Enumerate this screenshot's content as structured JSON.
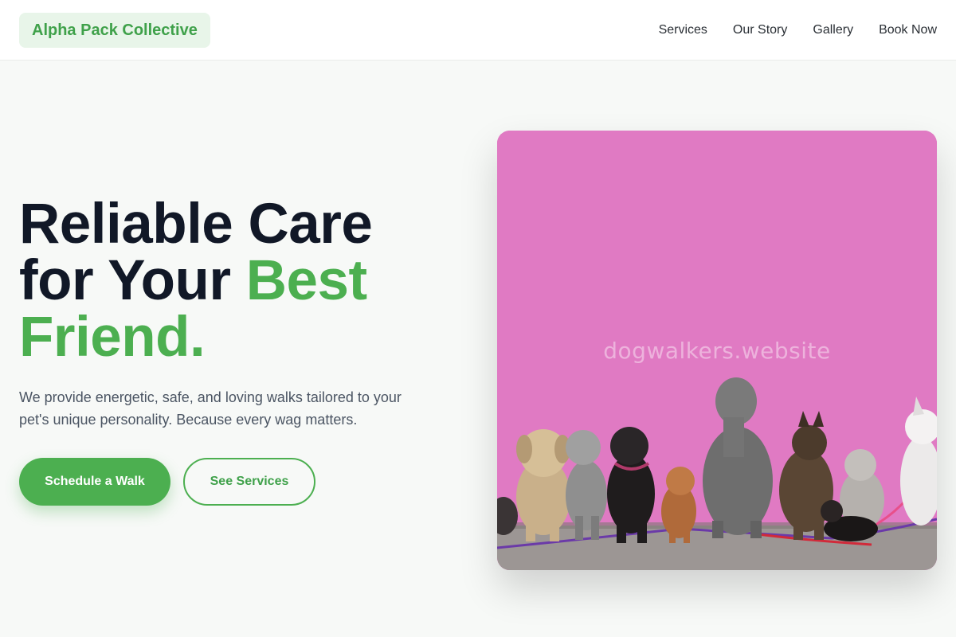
{
  "brand": {
    "name": "Alpha Pack Collective",
    "accent_color": "#4caf50"
  },
  "nav": {
    "items": [
      {
        "label": "Services"
      },
      {
        "label": "Our Story"
      },
      {
        "label": "Gallery"
      },
      {
        "label": "Book Now"
      }
    ]
  },
  "hero": {
    "headline_line1": "Reliable Care",
    "headline_line2_plain": "for Your ",
    "headline_line2_accent": "Best",
    "headline_line3_accent": "Friend.",
    "subtext": "We provide energetic, safe, and loving walks tailored to your pet's unique personality. Because every wag matters.",
    "primary_cta": "Schedule a Walk",
    "secondary_cta": "See Services"
  },
  "image": {
    "watermark": "dogwalkers.website",
    "wall_color": "#e27ec6"
  }
}
